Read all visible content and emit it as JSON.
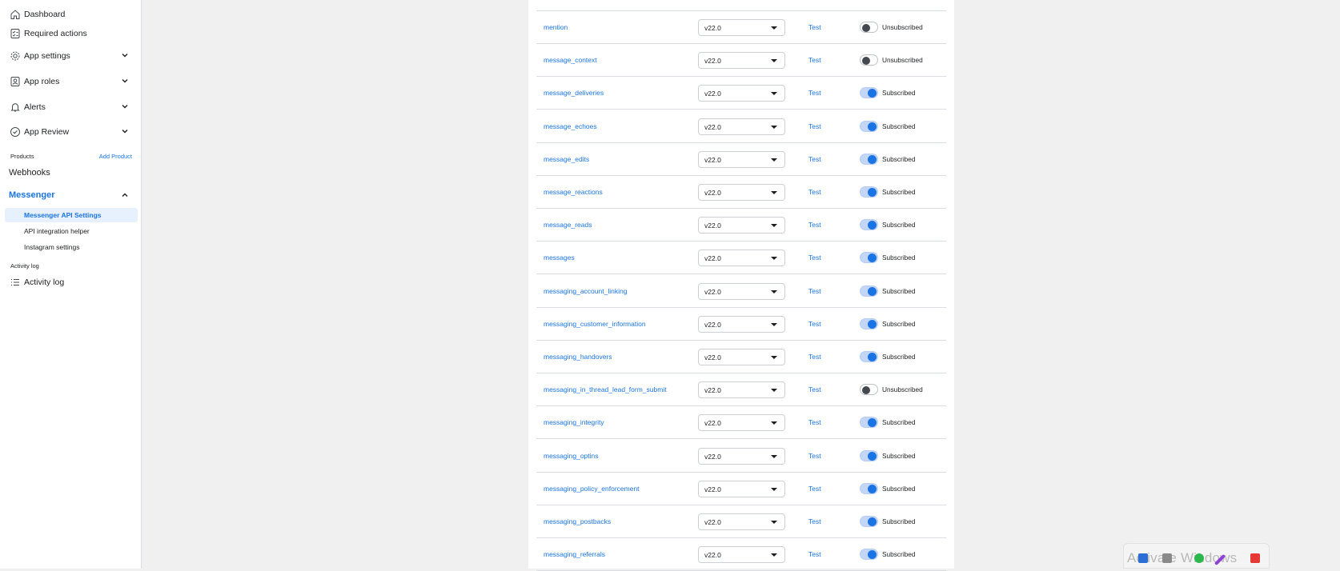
{
  "sidebar": {
    "items": [
      {
        "label": "Dashboard",
        "icon": "home-icon"
      },
      {
        "label": "Required actions",
        "icon": "checklist-icon"
      },
      {
        "label": "App settings",
        "icon": "gear-icon"
      },
      {
        "label": "App roles",
        "icon": "roles-icon"
      },
      {
        "label": "Alerts",
        "icon": "bell-icon"
      },
      {
        "label": "App Review",
        "icon": "shield-check-icon"
      }
    ],
    "products_label": "Products",
    "add_product_label": "Add Product",
    "webhooks_label": "Webhooks",
    "messenger_label": "Messenger",
    "messenger_sub": [
      {
        "label": "Messenger API Settings",
        "active": true
      },
      {
        "label": "API integration helper",
        "active": false
      },
      {
        "label": "Instagram settings",
        "active": false
      }
    ],
    "activity_section_label": "Activity log",
    "activity_item_label": "Activity log"
  },
  "webhook_fields": {
    "test_label": "Test",
    "rows": [
      {
        "name": "mention",
        "version": "v22.0",
        "subscribed": false,
        "status": "Unsubscribed"
      },
      {
        "name": "message_context",
        "version": "v22.0",
        "subscribed": false,
        "status": "Unsubscribed"
      },
      {
        "name": "message_deliveries",
        "version": "v22.0",
        "subscribed": true,
        "status": "Subscribed"
      },
      {
        "name": "message_echoes",
        "version": "v22.0",
        "subscribed": true,
        "status": "Subscribed"
      },
      {
        "name": "message_edits",
        "version": "v22.0",
        "subscribed": true,
        "status": "Subscribed"
      },
      {
        "name": "message_reactions",
        "version": "v22.0",
        "subscribed": true,
        "status": "Subscribed"
      },
      {
        "name": "message_reads",
        "version": "v22.0",
        "subscribed": true,
        "status": "Subscribed"
      },
      {
        "name": "messages",
        "version": "v22.0",
        "subscribed": true,
        "status": "Subscribed"
      },
      {
        "name": "messaging_account_linking",
        "version": "v22.0",
        "subscribed": true,
        "status": "Subscribed"
      },
      {
        "name": "messaging_customer_information",
        "version": "v22.0",
        "subscribed": true,
        "status": "Subscribed"
      },
      {
        "name": "messaging_handovers",
        "version": "v22.0",
        "subscribed": true,
        "status": "Subscribed"
      },
      {
        "name": "messaging_in_thread_lead_form_submit",
        "version": "v22.0",
        "subscribed": false,
        "status": "Unsubscribed"
      },
      {
        "name": "messaging_integrity",
        "version": "v22.0",
        "subscribed": true,
        "status": "Subscribed"
      },
      {
        "name": "messaging_optins",
        "version": "v22.0",
        "subscribed": true,
        "status": "Subscribed"
      },
      {
        "name": "messaging_policy_enforcement",
        "version": "v22.0",
        "subscribed": true,
        "status": "Subscribed"
      },
      {
        "name": "messaging_postbacks",
        "version": "v22.0",
        "subscribed": true,
        "status": "Subscribed"
      },
      {
        "name": "messaging_referrals",
        "version": "v22.0",
        "subscribed": true,
        "status": "Subscribed"
      }
    ]
  },
  "watermark": {
    "text": "Activate Windows"
  },
  "colors": {
    "accent": "#1b74e4",
    "toggle_on_track": "#c3d6f5",
    "background": "#f0f0f0"
  }
}
